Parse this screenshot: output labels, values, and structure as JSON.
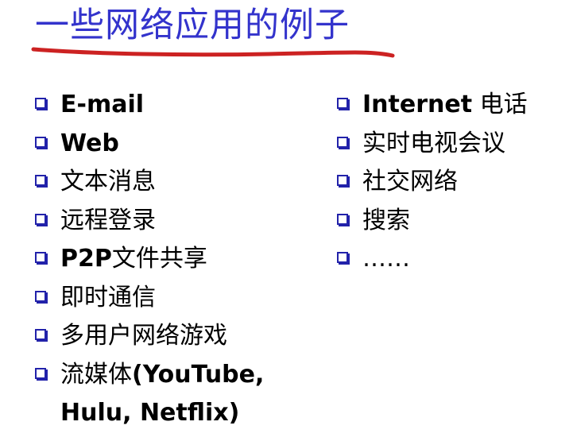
{
  "title": "一些网络应用的例子",
  "left_items": [
    {
      "en": "E-mail",
      "cn": ""
    },
    {
      "en": "Web",
      "cn": ""
    },
    {
      "en": "",
      "cn": "文本消息"
    },
    {
      "en": "",
      "cn": "远程登录"
    },
    {
      "en": "P2P",
      "cn": "文件共享"
    },
    {
      "en": "",
      "cn": "即时通信"
    },
    {
      "en": "",
      "cn": "多用户网络游戏"
    },
    {
      "en": "",
      "cn": "流媒体",
      "en2": "(YouTube,",
      "line2": "Hulu, Netflix)"
    }
  ],
  "right_items": [
    {
      "en": "Internet",
      "cn": " 电话"
    },
    {
      "en": "",
      "cn": "实时电视会议"
    },
    {
      "en": "",
      "cn": "社交网络"
    },
    {
      "en": "",
      "cn": "搜索"
    },
    {
      "en": "",
      "cn": "……"
    }
  ],
  "colors": {
    "title": "#3333cc",
    "underline": "#cc2222",
    "bullet": "#2222aa"
  },
  "icons": {
    "bullet": "square-bullet-icon"
  }
}
